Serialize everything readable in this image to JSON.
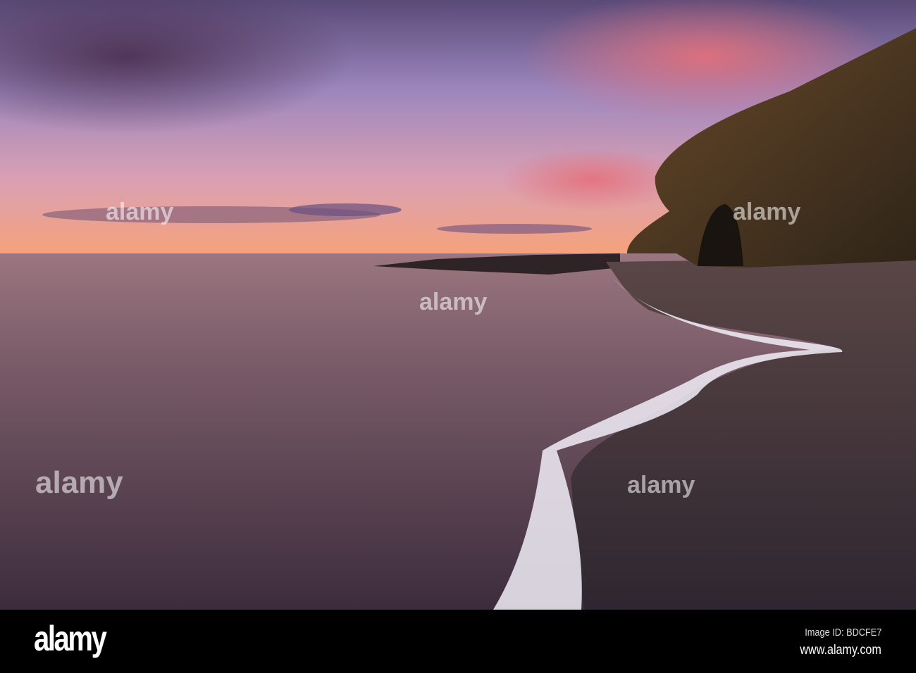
{
  "photo": {
    "subject": "Sunset over sea with pebble beach and cliff",
    "colors": {
      "sky_top": "#4e3a66",
      "sky_mid": "#b487b8",
      "horizon": "#f3a27e",
      "sea": "#6f5566",
      "beach": "#3e3236",
      "cliff": "#4a3622",
      "foam": "#f2eef8"
    }
  },
  "watermark": {
    "text": "alamy"
  },
  "footer": {
    "logo": "alamy",
    "image_id": "Image ID: BDCFE7",
    "website": "www.alamy.com"
  }
}
